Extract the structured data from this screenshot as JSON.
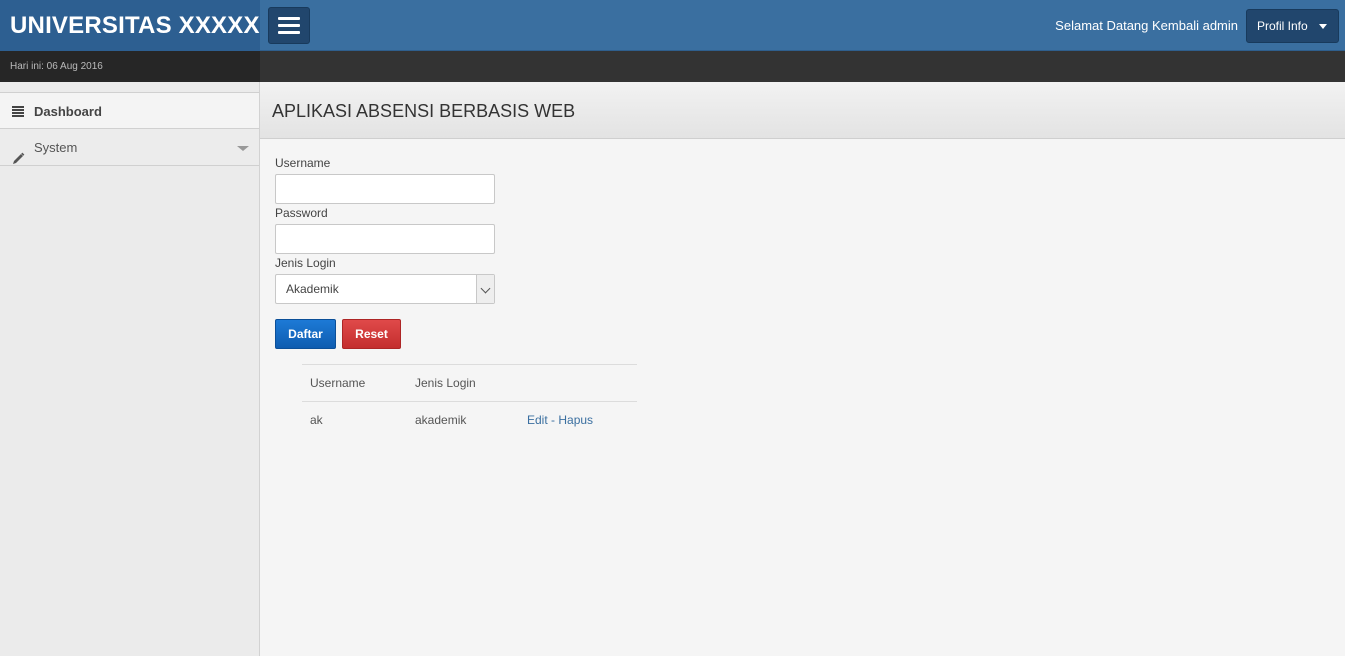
{
  "header": {
    "brand": "UNIVERSITAS XXXXX",
    "welcome": "Selamat Datang Kembali admin",
    "profile_button": "Profil Info"
  },
  "subbar": {
    "date": "Hari ini: 06 Aug 2016"
  },
  "sidebar": {
    "items": [
      {
        "label": "Dashboard",
        "icon": "list-icon"
      },
      {
        "label": "System",
        "icon": "pencil-icon"
      }
    ]
  },
  "page": {
    "title": "APLIKASI ABSENSI BERBASIS WEB"
  },
  "form": {
    "username_label": "Username",
    "username_value": "",
    "password_label": "Password",
    "password_value": "",
    "jenis_login_label": "Jenis Login",
    "jenis_login_selected": "Akademik",
    "daftar_button": "Daftar",
    "reset_button": "Reset"
  },
  "table": {
    "headers": [
      "Username",
      "Jenis Login"
    ],
    "rows": [
      {
        "username": "ak",
        "jenis_login": "akademik",
        "edit": "Edit",
        "separator": " - ",
        "hapus": "Hapus"
      }
    ]
  },
  "colors": {
    "header_bg": "#3a6fa0",
    "brand_bg": "#2d5f91",
    "primary_button": "#1d7ad6",
    "danger_button": "#e04a4a",
    "link": "#3a6fa0"
  }
}
